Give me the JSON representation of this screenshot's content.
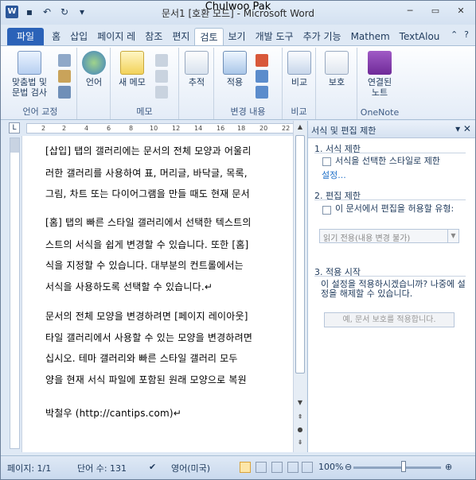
{
  "window": {
    "title": "문서1 [호환 모드] - Microsoft Word",
    "overlay_author": "Chulwoo Pak",
    "app_icon": "W"
  },
  "tabs": [
    "파일",
    "홈",
    "삽입",
    "페이지 레",
    "참조",
    "편지",
    "검토",
    "보기",
    "개발 도구",
    "추가 기능",
    "Mathem",
    "TextAlou"
  ],
  "ribbon": {
    "groups": [
      {
        "label": "언어 교정",
        "buttons": [
          "맞춤법 및\n문법 검사"
        ]
      },
      {
        "label": "",
        "buttons": [
          "언어"
        ]
      },
      {
        "label": "메모",
        "buttons": [
          "새 메모"
        ]
      },
      {
        "label": "",
        "buttons": [
          "추적"
        ]
      },
      {
        "label": "변경 내용",
        "buttons": [
          "적용"
        ]
      },
      {
        "label": "비교",
        "buttons": [
          "비교"
        ]
      },
      {
        "label": "",
        "buttons": [
          "보호"
        ]
      },
      {
        "label": "OneNote",
        "buttons": [
          "연결된\n노트"
        ]
      }
    ]
  },
  "ruler_ticks": [
    "2",
    "2",
    "4",
    "6",
    "8",
    "10",
    "12",
    "14",
    "16",
    "18",
    "20",
    "22"
  ],
  "document": {
    "lines": [
      "[삽입] 탭의 갤러리에는 문서의 전체 모양과 어울리",
      "러한 갤러리를 사용하여 표, 머리글, 바닥글, 목록,",
      "그림, 차트 또는 다이어그램을 만들 때도 현재 문서",
      "[홈] 탭의 빠른 스타일 갤러리에서 선택한 텍스트의",
      "스트의 서식을 쉽게 변경할 수 있습니다. 또한 [홈]",
      "식을 지정할 수 있습니다. 대부분의 컨트롤에서는",
      "서식을 사용하도록 선택할 수 있습니다.↵",
      "문서의 전체 모양을 변경하려면 [페이지 레이아웃]",
      "타일 갤러리에서 사용할 수 있는 모양을 변경하려면",
      "십시오. 테마 갤러리와 빠른 스타일 갤러리 모두 ",
      "양을 현재 서식 파일에 포함된 원래 모양으로 복원",
      "박철우 (http://cantips.com)↵"
    ]
  },
  "pane": {
    "title": "서식 및 편집 제한",
    "sec1_title": "1. 서식 제한",
    "sec1_check": "서식을 선택한 스타일로 제한",
    "sec1_link": "설정...",
    "sec2_title": "2. 편집 제한",
    "sec2_check": "이 문서에서 편집을 허용할 유형:",
    "sec2_select": "읽기 전용(내용 변경 불가)",
    "sec3_title": "3. 적용 시작",
    "sec3_text": "이 설정을 적용하시겠습니까? 나중에 설정을 해제할 수 있습니다.",
    "sec3_button": "예, 문서 보호를 적용합니다."
  },
  "status": {
    "page": "페이지: 1/1",
    "words": "단어 수: 131",
    "lang": "영어(미국)",
    "zoom": "100%"
  }
}
